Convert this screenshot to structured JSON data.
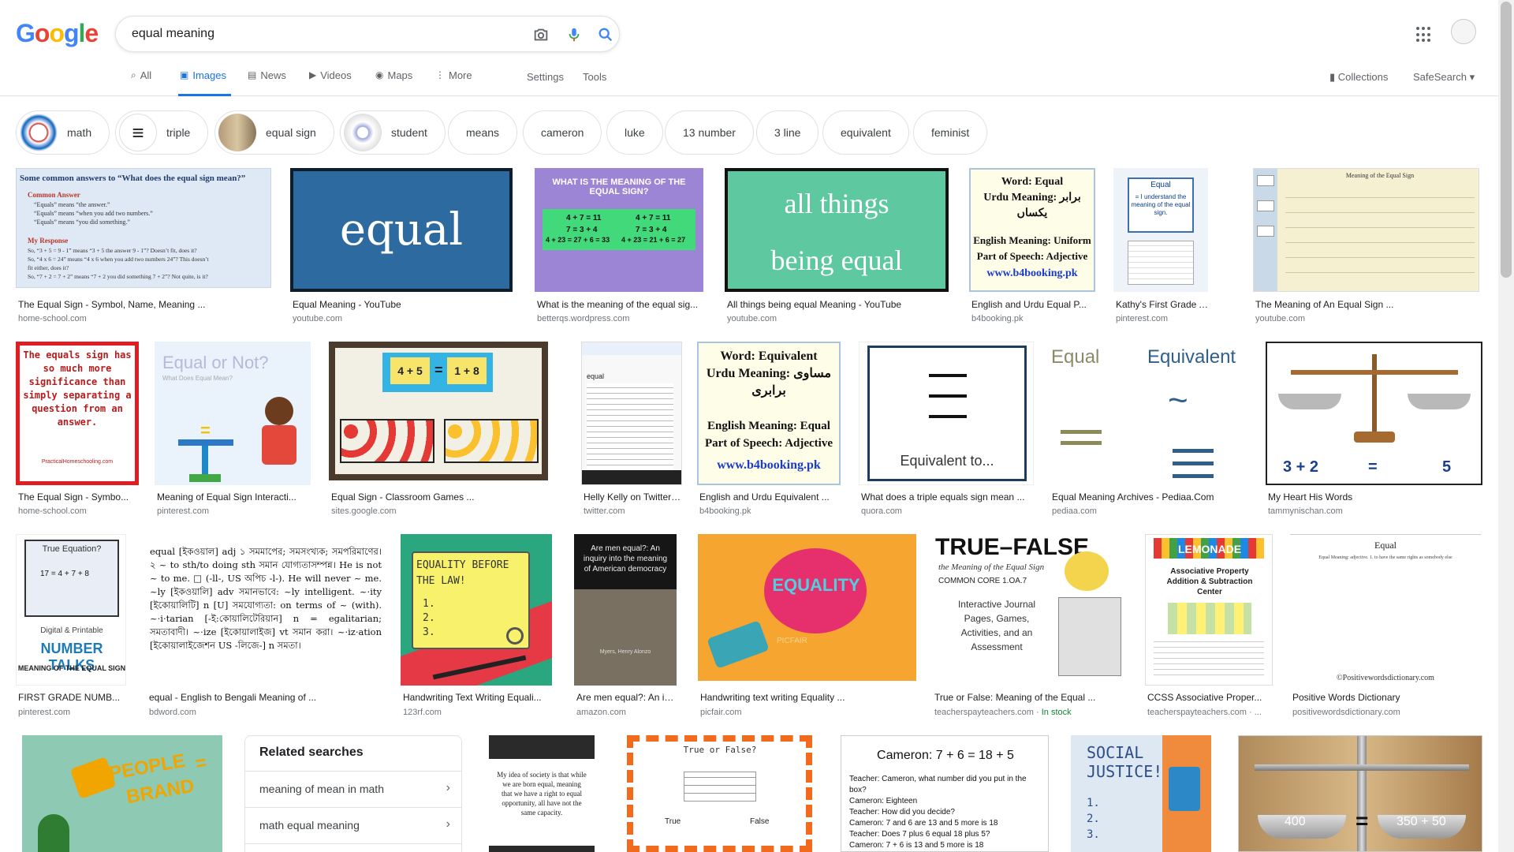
{
  "logo": "Google",
  "search": {
    "query": "equal meaning"
  },
  "tabs": [
    {
      "label": "All",
      "icon": "search-icon"
    },
    {
      "label": "Images",
      "icon": "image-icon"
    },
    {
      "label": "News",
      "icon": "news-icon"
    },
    {
      "label": "Videos",
      "icon": "video-icon"
    },
    {
      "label": "Maps",
      "icon": "map-pin-icon"
    },
    {
      "label": "More",
      "icon": "more-icon"
    }
  ],
  "settings_label": "Settings",
  "tools_label": "Tools",
  "collections_label": "Collections",
  "safesearch_label": "SafeSearch",
  "chips": [
    "math",
    "triple",
    "equal sign",
    "student",
    "means",
    "cameron",
    "luke",
    "13 number",
    "3 line",
    "equivalent",
    "feminist"
  ],
  "row1": [
    {
      "caption": "The Equal Sign - Symbol, Name, Meaning ...",
      "source": "home-school.com"
    },
    {
      "caption": "Equal Meaning - YouTube",
      "source": "youtube.com"
    },
    {
      "caption": "What is the meaning of the equal sig...",
      "source": "betterqs.wordpress.com"
    },
    {
      "caption": "All things being equal Meaning - YouTube",
      "source": "youtube.com"
    },
    {
      "caption": "English and Urdu Equal P...",
      "source": "b4booking.pk"
    },
    {
      "caption": "Kathy's First Grade Adv...",
      "source": "pinterest.com"
    },
    {
      "caption": "The Meaning of An Equal Sign ...",
      "source": "youtube.com"
    }
  ],
  "row2": [
    {
      "caption": "The Equal Sign - Symbo...",
      "source": "home-school.com"
    },
    {
      "caption": "Meaning of Equal Sign Interacti...",
      "source": "pinterest.com"
    },
    {
      "caption": "Equal Sign - Classroom Games ...",
      "source": "sites.google.com"
    },
    {
      "caption": "Helly Kelly on Twitter: ...",
      "source": "twitter.com"
    },
    {
      "caption": "English and Urdu Equivalent ...",
      "source": "b4booking.pk"
    },
    {
      "caption": "What does a triple equals sign mean ...",
      "source": "quora.com"
    },
    {
      "caption": "Equal Meaning Archives - Pediaa.Com",
      "source": "pediaa.com"
    },
    {
      "caption": "My Heart His Words",
      "source": "tammynischan.com"
    }
  ],
  "row3": [
    {
      "caption": "FIRST GRADE NUMB...",
      "source": "pinterest.com"
    },
    {
      "caption": "equal - English to Bengali Meaning of ...",
      "source": "bdword.com"
    },
    {
      "caption": "Handwriting Text Writing Equali...",
      "source": "123rf.com"
    },
    {
      "caption": "Are men equal?: An in...",
      "source": "amazon.com"
    },
    {
      "caption": "Handwriting text writing Equality ...",
      "source": "picfair.com"
    },
    {
      "caption": "True or False: Meaning of the Equal ...",
      "source": "teacherspayteachers.com",
      "extra": "In stock"
    },
    {
      "caption": "CCSS Associative Proper...",
      "source": "teacherspayteachers.com · ..."
    },
    {
      "caption": "Positive Words Dictionary",
      "source": "positivewordsdictionary.com"
    }
  ],
  "related": {
    "title": "Related searches",
    "items": [
      "meaning of mean in math",
      "math equal meaning"
    ]
  },
  "img_text": {
    "r1_1_title": "Some common answers to “What does the equal sign mean?”",
    "r1_1_sub": "Common Answer",
    "r1_1_lines": [
      "“Equals” means “the answer.”",
      "“Equals” means “when you add two numbers.”",
      "“Equals” means “you did something.”"
    ],
    "r1_1_sub2": "My Response",
    "r1_1_lines2": [
      "So, “3 + 5 = 9 - 1” means “3 + 5 the answer 9 - 1”? Doesn’t fit, does it?",
      "So, “4 x 6 = 24” means “4 x 6 when you add two numbers 24”? This doesn’t",
      "fit either, does it?",
      "So, “7 + 2 = 7 + 2” means “7 + 2 you did something 7 + 2”? Not quite, is it?"
    ],
    "r1_2": "equal",
    "r1_3_title": "WHAT IS THE MEANING OF THE EQUAL SIGN?",
    "r1_3_eq": [
      "4 + 7 = 11",
      "7 = 3 + 4",
      "4 + 23 = 27 + 6 = 33",
      "4 + 7 = 11",
      "7 = 3 + 4",
      "4 + 23 = 21 + 6 = 27"
    ],
    "r1_4a": "all things",
    "r1_4b": "being equal",
    "r1_5": [
      "Word: Equal",
      "Urdu Meaning: برابر",
      "یکساں",
      "English Meaning: Uniform",
      "Part of Speech: Adjective",
      "www.b4booking.pk"
    ],
    "r1_6": [
      "Equal",
      "= I understand the meaning of the equal sign."
    ],
    "r1_7": [
      "Meaning of the Equal Sign"
    ],
    "r2_1": "The equals sign has so much more significance than simply separating a question from an answer.",
    "r2_1b": "PracticalHomeschooling.com",
    "r2_2": [
      "Equal or Not?",
      "What Does Equal Mean?",
      "="
    ],
    "r2_3": [
      "4 + 5",
      "=",
      "1 + 8"
    ],
    "r2_4": [
      "equal"
    ],
    "r2_5": [
      "Word: Equivalent",
      "Urdu Meaning: مساوی",
      "برابری",
      "English Meaning: Equal",
      "Part of Speech: Adjective",
      "www.b4booking.pk"
    ],
    "r2_6": [
      "Equivalent to..."
    ],
    "r2_7": [
      "Equal",
      "Equivalent",
      "=",
      "~",
      "≡"
    ],
    "r2_8": [
      "3 + 2",
      "=",
      "5"
    ],
    "r3_1": [
      "True Equation?",
      "17 = 4 + 7 + 8",
      "Digital & Printable",
      "NUMBER TALKS",
      "MEANING OF THE EQUAL SIGN"
    ],
    "r3_2": [
      "equal [ইকওয়াল] adj ১ সমমাপের; সমসংখ্যক; সমপরিমাণের। ২ ~ to sth/to doing sth সমান যোগ্যতাসম্পন্ন। He is not ~ to me. □ (-ll-, US অপিচ -l-). He will never ~ me. ~ly [ইকওয়ালি] adv সমানভাবে: ~ly intelligent. ~·ity [ইকোয়ালিটি] n [U] সমযোগ্যতা: on terms of ~ (with). ~·i·tarian [-ই:কোয়ালিটেরিয়ান] n = egalitarian; সমতাবাদী। ~·ize [ইকোয়ালাইজ] vt সমান করা। ~·iz·ation [ইকোয়ালাইজেশন US -লিজে-] n সমতা।"
    ],
    "r3_3": [
      "EQUALITY BEFORE",
      "THE LAW!",
      "1.",
      "2.",
      "3."
    ],
    "r3_4": [
      "Are men equal?: An inquiry into the meaning of American democracy",
      "Myers, Henry Alonzo"
    ],
    "r3_5": [
      "EQUALITY",
      "PICFAIR"
    ],
    "r3_6": [
      "TRUE–FALSE",
      "the Meaning of the Equal Sign",
      "COMMON CORE 1.OA.7",
      "Interactive Journal",
      "Pages, Games,",
      "Activities, and an",
      "Assessment"
    ],
    "r3_7": [
      "LEMONADE",
      "Associative Property",
      "Addition & Subtraction",
      "Center"
    ],
    "r3_8": [
      "Equal",
      "Equal Meaning: adjective. 1. to have the same rights as somebody else",
      "©Positivewordsdictionary.com"
    ],
    "r4_1": [
      "PEOPLE",
      "=",
      "BRAND"
    ],
    "r4_2": [
      "My idea of society is that while we are born equal, meaning that we have a right to equal opportunity, all have not the same capacity."
    ],
    "r4_3": [
      "True or False?",
      "True",
      "False"
    ],
    "r4_4": [
      "Cameron: 7 + 6 = 18 + 5",
      "Teacher: Cameron, what number did you put in the box?",
      "Cameron: Eighteen",
      "Teacher: How did you decide?",
      "Cameron: 7 and 6 are 13 and 5 more is 18",
      "Teacher: Does 7 plus 6 equal 18 plus 5?",
      "Cameron: 7 + 6 is 13 and 5 more is 18"
    ],
    "r4_5": [
      "SOCIAL",
      "JUSTICE!",
      "1.",
      "2.",
      "3."
    ],
    "r4_6": [
      "400",
      "=",
      "350 + 50"
    ]
  },
  "colors": {
    "accent": "#1a73e8",
    "link_source": "#70757a",
    "in_stock": "#188038"
  }
}
